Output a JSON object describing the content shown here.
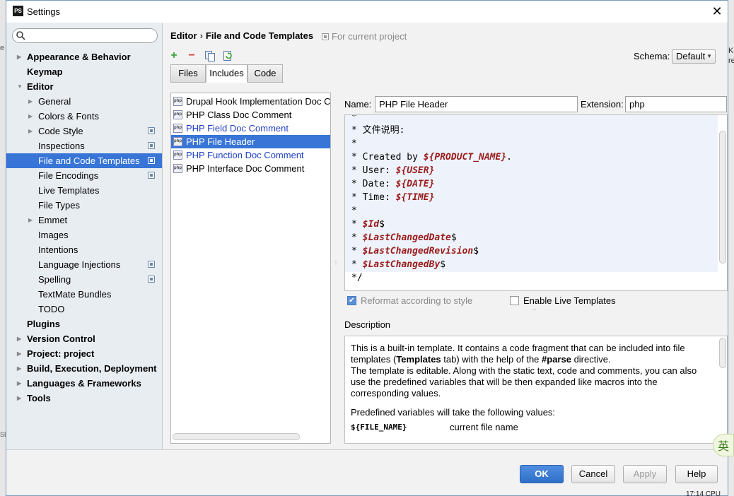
{
  "window": {
    "title": "Settings",
    "close_glyph": "✕"
  },
  "background_fragments": {
    "left_chars": [
      "e",
      "SL"
    ],
    "right_chars": [
      "K",
      "re"
    ],
    "tray_text": "17:14   CPU"
  },
  "sidebar": {
    "search_placeholder": "",
    "items": [
      {
        "label": "Appearance & Behavior"
      },
      {
        "label": "Keymap"
      },
      {
        "label": "Editor"
      },
      {
        "label": "General"
      },
      {
        "label": "Colors & Fonts"
      },
      {
        "label": "Code Style"
      },
      {
        "label": "Inspections"
      },
      {
        "label": "File and Code Templates"
      },
      {
        "label": "File Encodings"
      },
      {
        "label": "Live Templates"
      },
      {
        "label": "File Types"
      },
      {
        "label": "Emmet"
      },
      {
        "label": "Images"
      },
      {
        "label": "Intentions"
      },
      {
        "label": "Language Injections"
      },
      {
        "label": "Spelling"
      },
      {
        "label": "TextMate Bundles"
      },
      {
        "label": "TODO"
      },
      {
        "label": "Plugins"
      },
      {
        "label": "Version Control"
      },
      {
        "label": "Project: project"
      },
      {
        "label": "Build, Execution, Deployment"
      },
      {
        "label": "Languages & Frameworks"
      },
      {
        "label": "Tools"
      }
    ]
  },
  "header": {
    "crumb_parent": "Editor",
    "crumb_sep": "›",
    "crumb_current": "File and Code Templates",
    "scope_hint": "For current project"
  },
  "toolbar": {
    "add_glyph": "+",
    "remove_glyph": "−"
  },
  "schema": {
    "label": "Schema:",
    "value": "Default"
  },
  "tabs": [
    {
      "label": "Files"
    },
    {
      "label": "Includes"
    },
    {
      "label": "Code"
    }
  ],
  "templates": [
    {
      "label": "Drupal Hook Implementation Doc Comment"
    },
    {
      "label": "PHP Class Doc Comment"
    },
    {
      "label": "PHP Field Doc Comment"
    },
    {
      "label": "PHP File Header"
    },
    {
      "label": "PHP Function Doc Comment"
    },
    {
      "label": "PHP Interface Doc Comment"
    }
  ],
  "file_icon_text": "php",
  "form": {
    "name_label": "Name:",
    "name_value": "PHP File Header",
    "ext_label": "Extension:",
    "ext_value": "php"
  },
  "editor_lines": [
    {
      "plain": "*"
    },
    {
      "plain": "* 文件说明:"
    },
    {
      "plain": "*"
    },
    {
      "plain": "* Created by ",
      "var": "${PRODUCT_NAME}",
      "tail": "."
    },
    {
      "plain": "* User: ",
      "var": "${USER}"
    },
    {
      "plain": "* Date: ",
      "var": "${DATE}"
    },
    {
      "plain": "* Time: ",
      "var": "${TIME}"
    },
    {
      "plain": "*"
    },
    {
      "plain": "* ",
      "var": "$Id",
      "tail": "$"
    },
    {
      "plain": "* ",
      "var": "$LastChangedDate",
      "tail": "$"
    },
    {
      "plain": "* ",
      "var": "$LastChangedRevision",
      "tail": "$"
    },
    {
      "plain": "* ",
      "var": "$LastChangedBy",
      "tail": "$"
    },
    {
      "plain": "*/"
    }
  ],
  "options": {
    "reformat_label": "Reformat according to style",
    "reformat_checked": true,
    "live_label": "Enable Live Templates",
    "live_checked": false
  },
  "description": {
    "label": "Description",
    "p1_a": "This is a built-in template. It contains a code fragment that can be included into file templates (",
    "p1_bold1": "Templates",
    "p1_b": " tab) with the help of the ",
    "p1_bold2": "#parse",
    "p1_c": " directive.",
    "p1_d": "The template is editable. Along with the static text, code and comments, you can also use the predefined variables that will be then expanded like macros into the corresponding values.",
    "p2": "Predefined variables will take the following values:",
    "var_name": "${FILE_NAME}",
    "var_desc": "current file name"
  },
  "buttons": {
    "ok": "OK",
    "cancel": "Cancel",
    "apply": "Apply",
    "help": "Help"
  },
  "ime_text": "英",
  "colors": {
    "selection": "#3875d7",
    "modified": "#1f3fc4",
    "variable": "#9b1b1b",
    "add": "#3aa33a",
    "remove": "#d33b3b"
  }
}
